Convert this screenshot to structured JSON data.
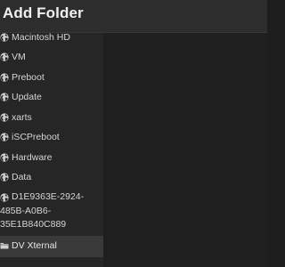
{
  "dialog": {
    "title": "Add Folder"
  },
  "sidebar": {
    "items": [
      {
        "label": "Macintosh HD",
        "icon": "globe-icon"
      },
      {
        "label": "VM",
        "icon": "globe-icon"
      },
      {
        "label": "Preboot",
        "icon": "globe-icon"
      },
      {
        "label": "Update",
        "icon": "globe-icon"
      },
      {
        "label": "xarts",
        "icon": "globe-icon"
      },
      {
        "label": "iSCPreboot",
        "icon": "globe-icon"
      },
      {
        "label": "Hardware",
        "icon": "globe-icon"
      },
      {
        "label": "Data",
        "icon": "globe-icon"
      },
      {
        "label_lines": [
          "D1E9363E-2924-",
          "485B-A0B6-",
          "35E1B840C889"
        ],
        "icon": "globe-icon"
      },
      {
        "label": "DV Xternal",
        "icon": "folder-icon",
        "selected": true
      }
    ]
  },
  "colors": {
    "background": "#1e1e1e",
    "title_bar": "#2d2d2d",
    "selected_row": "#3a3a3a",
    "text": "#d6d6d6"
  }
}
